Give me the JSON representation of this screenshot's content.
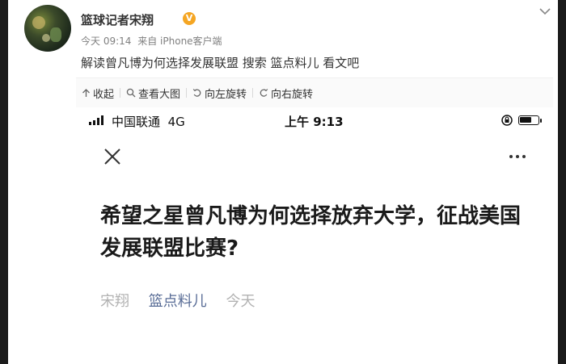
{
  "post": {
    "username": "篮球记者宋翔",
    "time": "今天 09:14",
    "source": "来自 iPhone客户端",
    "text": "解读曾凡博为何选择发展联盟 搜索 篮点料儿 看文吧"
  },
  "toolbar": {
    "collapse": "收起",
    "view_large": "查看大图",
    "rotate_left": "向左旋转",
    "rotate_right": "向右旋转"
  },
  "screenshot": {
    "carrier": "中国联通",
    "network": "4G",
    "time": "上午 9:13",
    "battery_level": 0.7,
    "article": {
      "title": "希望之星曾凡博为何选择放弃大学，征战美国发展联盟比赛?",
      "author": "宋翔",
      "source": "篮点料儿",
      "date": "今天"
    }
  },
  "icons": {
    "verified": "verified-badge-icon",
    "chevron": "chevron-down-icon",
    "collapse": "arrow-up-icon",
    "zoom": "magnifier-icon",
    "rotate_left": "rotate-left-icon",
    "rotate_right": "rotate-right-icon",
    "signal": "signal-bars-icon",
    "lock": "orientation-lock-icon",
    "battery": "battery-icon",
    "close": "close-icon",
    "more": "more-dots-icon"
  },
  "colors": {
    "verified_badge": "#f5a623",
    "link_blue": "#576b95",
    "meta_gray": "#808080"
  }
}
